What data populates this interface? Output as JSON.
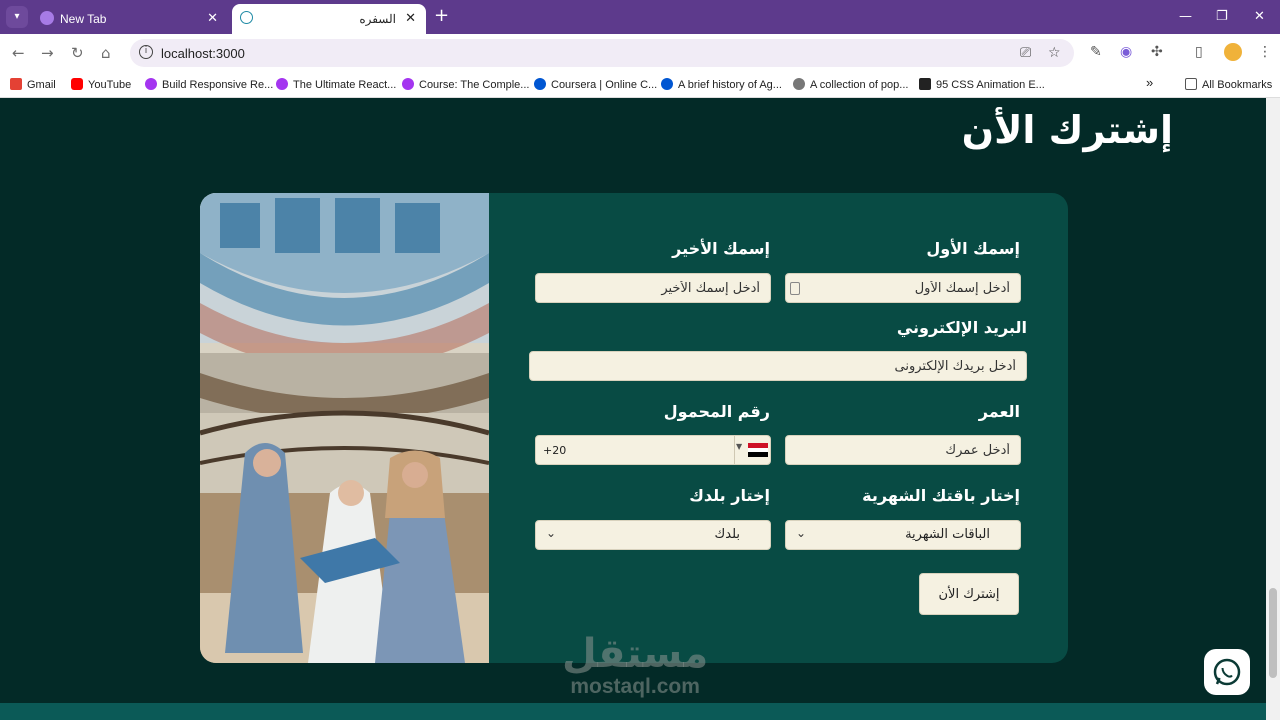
{
  "browser": {
    "tabs": [
      {
        "title": "New Tab",
        "active": false
      },
      {
        "title": "السفره",
        "active": true
      }
    ],
    "url": "localhost:3000",
    "bookmarks": [
      {
        "label": "Gmail",
        "icon": "gmail-icon"
      },
      {
        "label": "YouTube",
        "icon": "youtube-icon"
      },
      {
        "label": "Build Responsive Re...",
        "icon": "udemy-icon"
      },
      {
        "label": "The Ultimate React...",
        "icon": "udemy-icon"
      },
      {
        "label": "Course: The Comple...",
        "icon": "udemy-icon"
      },
      {
        "label": "Coursera | Online C...",
        "icon": "coursera-icon"
      },
      {
        "label": "A brief history of Ag...",
        "icon": "coursera-icon"
      },
      {
        "label": "A collection of pop...",
        "icon": "globe-icon"
      },
      {
        "label": "95 CSS Animation E...",
        "icon": "freefrontend-icon"
      }
    ],
    "all_bookmarks": "All Bookmarks"
  },
  "page": {
    "title": "إشترك الأن",
    "form": {
      "first_name_label": "إسمك الأول",
      "first_name_placeholder": "أدخل إسمك الأول",
      "last_name_label": "إسمك الأخير",
      "last_name_placeholder": "أدخل إسمك الأخير",
      "email_label": "البريد الإلكتروني",
      "email_placeholder": "أدخل بريدك الإلكترونى",
      "age_label": "العمر",
      "age_placeholder": "أدخل عمرك",
      "phone_label": "رقم المحمول",
      "phone_code": "+20",
      "plan_label": "إختار باقتك الشهرية",
      "plan_value": "الباقات الشهرية",
      "country_label": "إختار بلدك",
      "country_value": "بلدك",
      "submit_label": "إشترك الأن"
    },
    "watermark": {
      "arabic": "مستقل",
      "latin": "mostaql.com"
    }
  },
  "colors": {
    "page_bg": "#032a27",
    "card_bg": "#084b44",
    "field_bg": "#f5f1e1",
    "tabbar": "#5d3a8c"
  }
}
